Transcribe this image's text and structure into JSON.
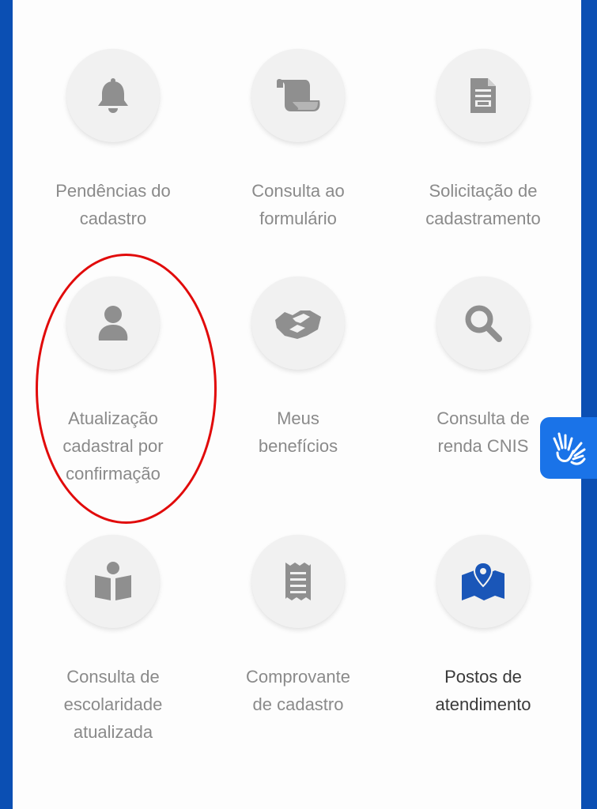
{
  "colors": {
    "brand_blue": "#0b4fb3",
    "icon_gray": "#8f8f8f",
    "icon_active": "#1a56b8",
    "highlight_red": "#e10a0a",
    "accessibility_blue": "#1a73e8"
  },
  "menu": {
    "items": [
      {
        "label": "Pendências do\ncadastro",
        "icon": "bell-icon"
      },
      {
        "label": "Consulta ao\nformulário",
        "icon": "scroll-icon"
      },
      {
        "label": "Solicitação de\ncadastramento",
        "icon": "document-icon"
      },
      {
        "label": "Atualização\ncadastral por\nconfirmação",
        "icon": "user-icon",
        "highlighted": true
      },
      {
        "label": "Meus\nbenefícios",
        "icon": "handshake-icon"
      },
      {
        "label": "Consulta de\nrenda CNIS",
        "icon": "search-icon"
      },
      {
        "label": "Consulta de\nescolaridade\natualizada",
        "icon": "reader-icon"
      },
      {
        "label": "Comprovante\nde cadastro",
        "icon": "receipt-icon"
      },
      {
        "label": "Postos de\natendimento",
        "icon": "map-pin-icon",
        "active": true
      }
    ]
  },
  "accessibility": {
    "icon": "sign-language-icon"
  }
}
